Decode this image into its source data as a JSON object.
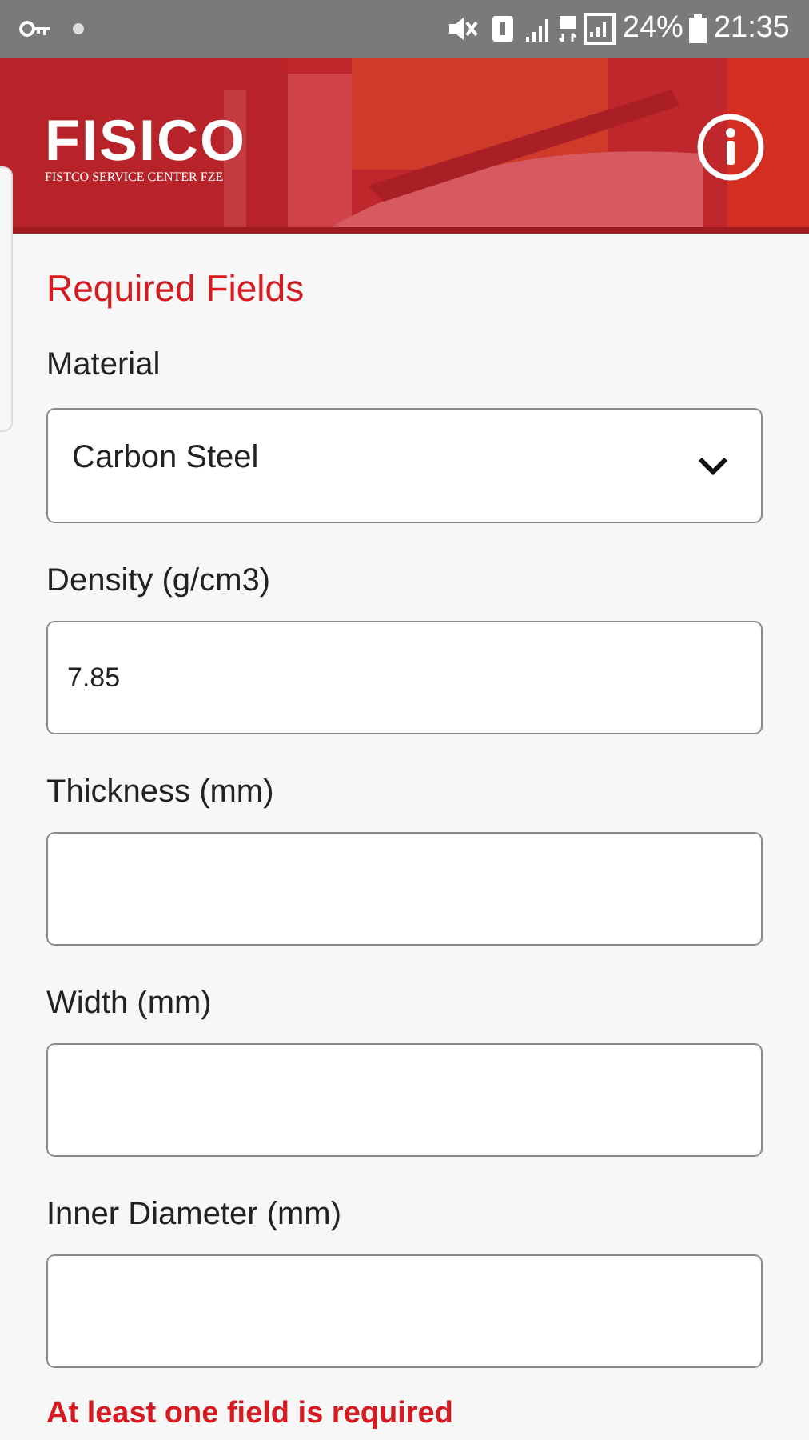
{
  "status_bar": {
    "battery": "24%",
    "time": "21:35"
  },
  "header": {
    "logo": "FISICO",
    "logo_subtitle": "FISTCO SERVICE CENTER FZE"
  },
  "section_title": "Required Fields",
  "fields": [
    {
      "kind": "select",
      "label": "Material",
      "value": "Carbon Steel"
    },
    {
      "kind": "input",
      "label": "Density (g/cm3)",
      "value": "7.85"
    },
    {
      "kind": "input",
      "label": "Thickness (mm)"
    },
    {
      "kind": "input",
      "label": "Width (mm)"
    },
    {
      "kind": "input",
      "label": "Inner Diameter (mm)"
    }
  ],
  "error_message": "At least one field is required"
}
